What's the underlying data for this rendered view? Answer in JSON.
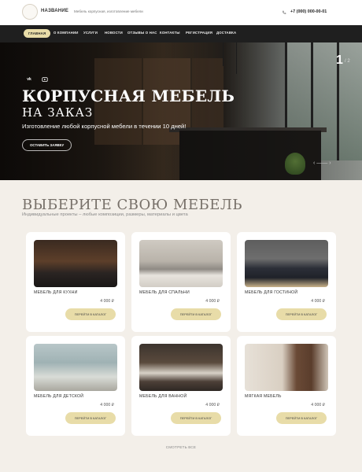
{
  "header": {
    "brand": "НАЗВАНИЕ",
    "tagline": "Мебель корпусная, изготовление мебели",
    "phone": "+7 (000) 000-00-01"
  },
  "nav": {
    "items": [
      "ГЛАВНАЯ",
      "О КОМПАНИИ",
      "УСЛУГИ",
      "НОВОСТИ",
      "ОТЗЫВЫ О НАС",
      "КОНТАКТЫ",
      "РЕГИСТРАЦИЯ",
      "ДОСТАВКА"
    ],
    "active": "ГЛАВНАЯ"
  },
  "hero": {
    "social": [
      "vk-icon",
      "youtube-icon"
    ],
    "title": "КОРПУСНАЯ МЕБЕЛЬ",
    "subtitle": "НА ЗАКАЗ",
    "description": "Изготовление любой корпусной мебели в течении 10 дней!",
    "cta": "ОСТАВИТЬ ЗАЯВКУ",
    "slide_current": "1",
    "slide_total": "/ 2",
    "arrows": "‹  ——  ›"
  },
  "section": {
    "title": "ВЫБЕРИТЕ СВОЮ МЕБЕЛЬ",
    "subtitle": "Индивидуальные проекты – любые композиции, размеры, материалы и цвета"
  },
  "cards": [
    {
      "name": "МЕБЕЛЬ ДЛЯ КУХНИ",
      "price": "4 000 ₽",
      "button": "ПЕРЕЙТИ В КАТАЛОГ"
    },
    {
      "name": "МЕБЕЛЬ ДЛЯ СПАЛЬНИ",
      "price": "4 000 ₽",
      "button": "ПЕРЕЙТИ В КАТАЛОГ"
    },
    {
      "name": "МЕБЕЛЬ ДЛЯ ГОСТИНОЙ",
      "price": "4 000 ₽",
      "button": "ПЕРЕЙТИ В КАТАЛОГ"
    },
    {
      "name": "МЕБЕЛЬ ДЛЯ ДЕТСКОЙ",
      "price": "4 000 ₽",
      "button": "ПЕРЕЙТИ В КАТАЛОГ"
    },
    {
      "name": "МЕБЕЛЬ ДЛЯ ВАННОЙ",
      "price": "4 000 ₽",
      "button": "ПЕРЕЙТИ В КАТАЛОГ"
    },
    {
      "name": "МЯГКАЯ МЕБЕЛЬ",
      "price": "4 000 ₽",
      "button": "ПЕРЕЙТИ В КАТАЛОГ"
    }
  ],
  "footer": {
    "view_all": "СМОТРЕТЬ ВСЕ"
  },
  "colors": {
    "accent": "#e8dca8",
    "nav_bg": "#1f1f1f",
    "page_bg": "#f3efe9"
  }
}
